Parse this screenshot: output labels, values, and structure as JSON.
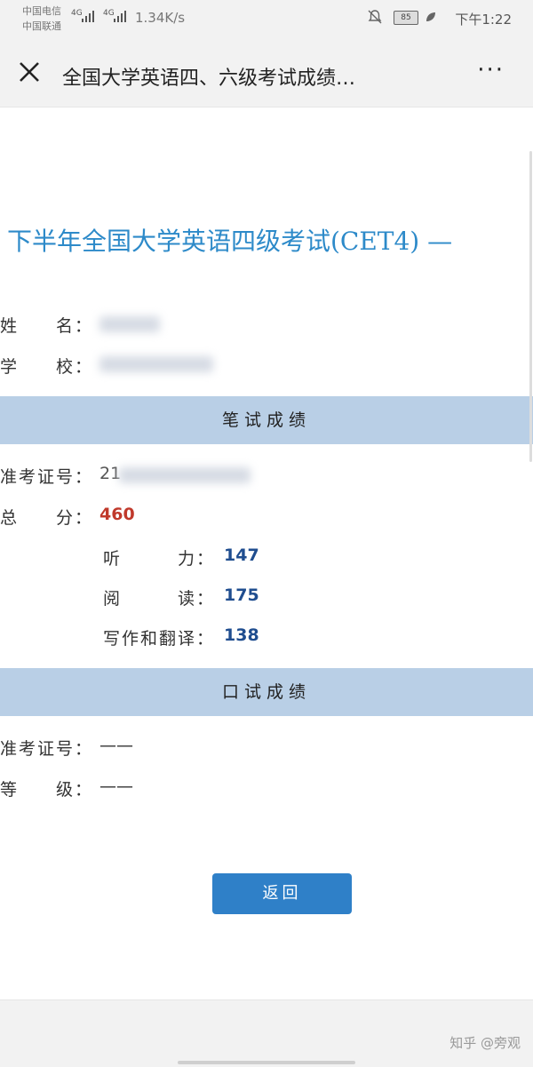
{
  "status": {
    "carrier1": "中国电信",
    "carrier2": "中国联通",
    "net1": "4G",
    "net2": "4G",
    "speed": "1.34K/s",
    "battery": "85",
    "time": "下午1:22"
  },
  "nav": {
    "title": "全国大学英语四、六级考试成绩…",
    "more": "···"
  },
  "exam": {
    "title": "下半年全国大学英语四级考试(CET4) —"
  },
  "student": {
    "name_label": "姓　　名：",
    "school_label": "学　　校：",
    "id_partial": "21"
  },
  "written": {
    "section_title": "笔试成绩",
    "ticket_label": "准考证号：",
    "total_label": "总　　分：",
    "total": "460",
    "listening_label": "听　　　力：",
    "listening": "147",
    "reading_label": "阅　　　读：",
    "reading": "175",
    "writing_label": "写作和翻译：",
    "writing": "138"
  },
  "oral": {
    "section_title": "口试成绩",
    "ticket_label": "准考证号：",
    "ticket": "——",
    "grade_label": "等　　级：",
    "grade": "——"
  },
  "actions": {
    "back": "返回"
  },
  "footer": {
    "watermark": "知乎 @旁观"
  }
}
